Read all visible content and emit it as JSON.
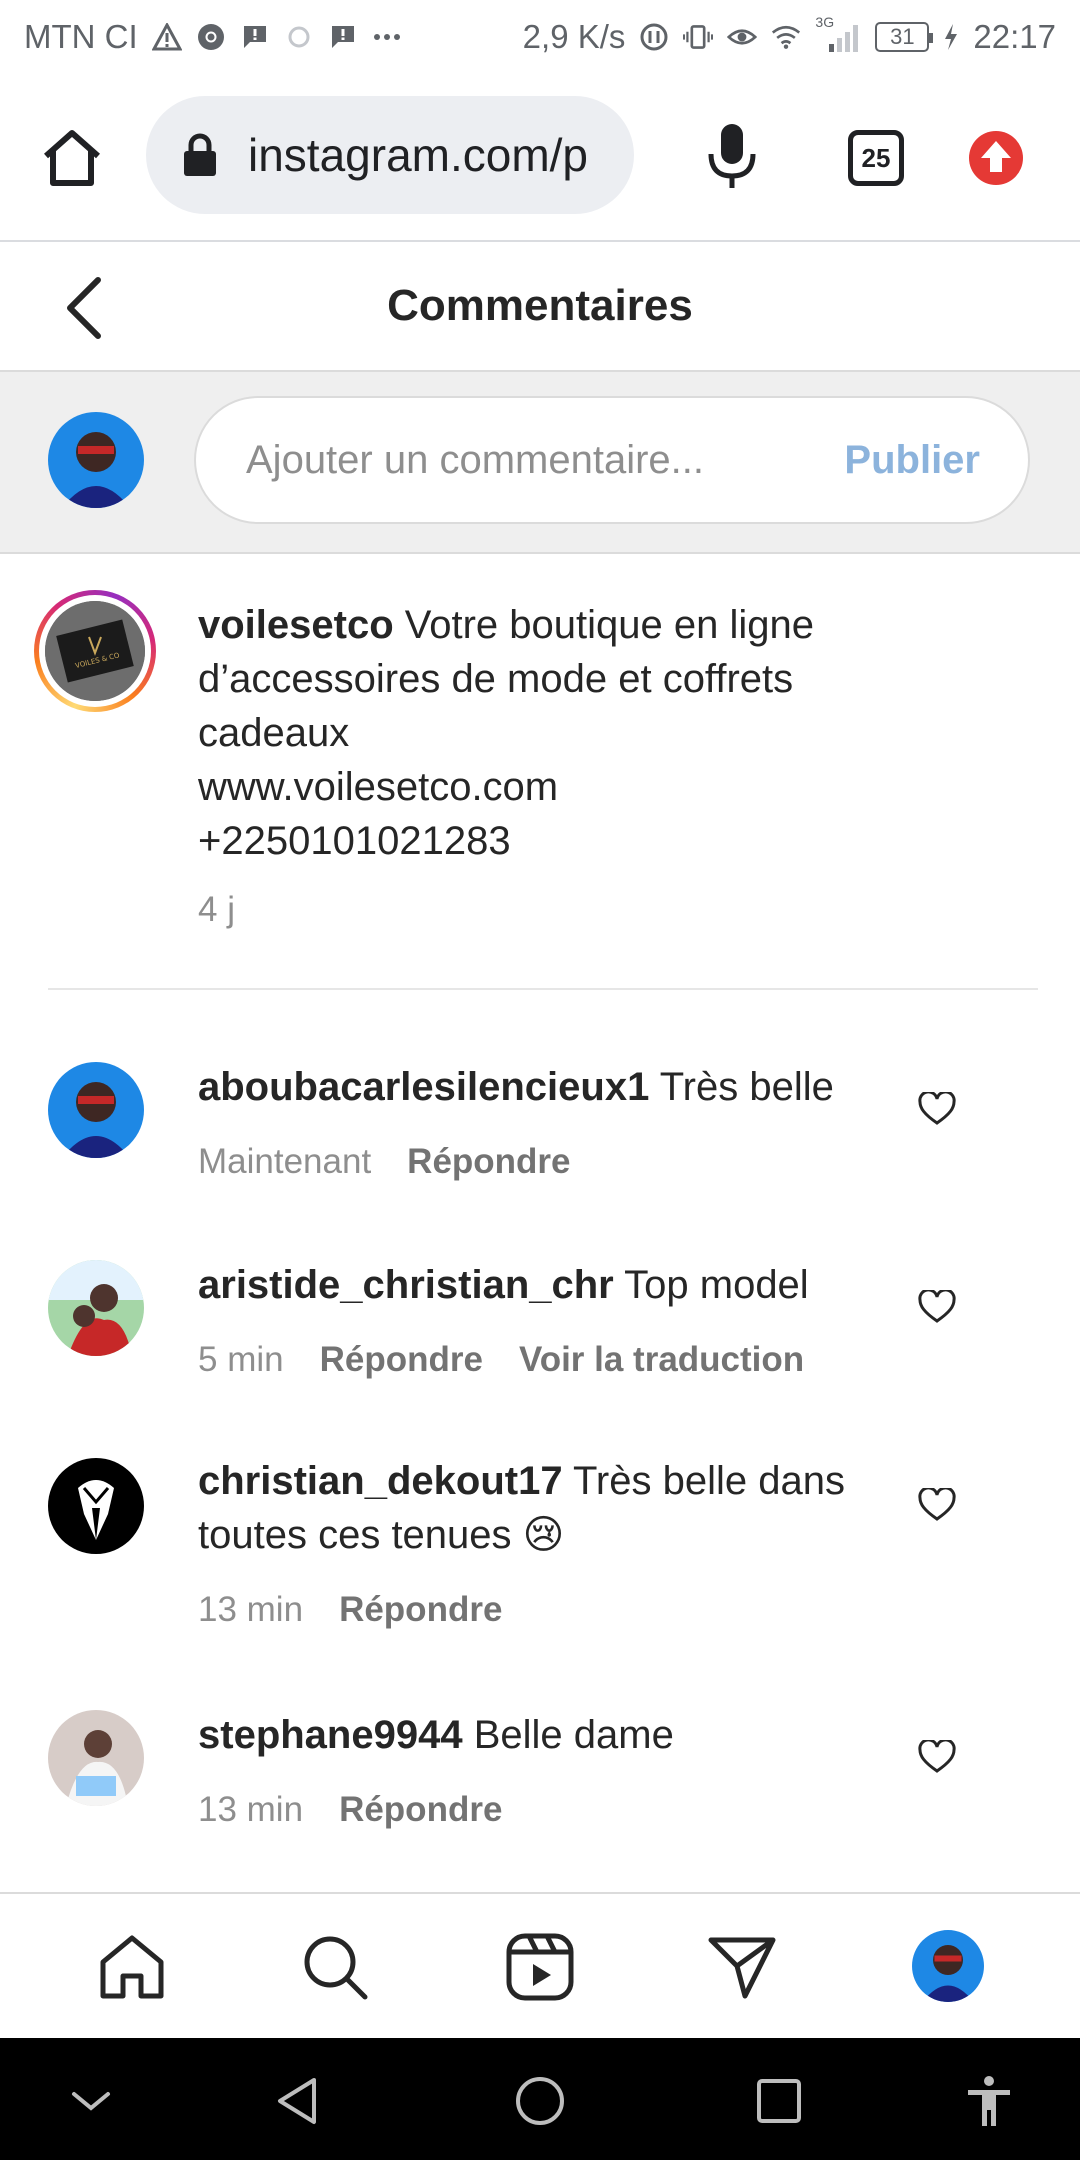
{
  "status_bar": {
    "carrier": "MTN CI",
    "speed": "2,9 K/s",
    "network": "3G",
    "battery": "31",
    "time": "22:17"
  },
  "browser": {
    "url": "instagram.com/p",
    "tab_count": "25"
  },
  "header": {
    "title": "Commentaires"
  },
  "composer": {
    "placeholder": "Ajouter un commentaire...",
    "publish_label": "Publier"
  },
  "caption": {
    "username": "voilesetco",
    "text_line1": "Votre boutique en ligne",
    "text_line2": "d’accessoires de mode et coffrets",
    "text_line3": "cadeaux",
    "website": "www.voilesetco.com",
    "phone": "+2250101021283",
    "time": "4 j",
    "logo_text": "VOILES & CO"
  },
  "comments": [
    {
      "username": "aboubacarlesilencieux1",
      "text": "Très belle",
      "time": "Maintenant",
      "reply_label": "Répondre"
    },
    {
      "username": "aristide_christian_chr",
      "text": "Top model",
      "time": "5 min",
      "reply_label": "Répondre",
      "translate_label": "Voir la traduction"
    },
    {
      "username": "christian_dekout17",
      "text": "Très belle dans toutes ces tenues 😢",
      "time": "13 min",
      "reply_label": "Répondre"
    },
    {
      "username": "stephane9944",
      "text": "Belle dame",
      "time": "13 min",
      "reply_label": "Répondre"
    }
  ],
  "colors": {
    "publish_disabled": "#8cb3dc",
    "update_badge": "#e53935",
    "meta_gray": "#8e8e8e"
  }
}
